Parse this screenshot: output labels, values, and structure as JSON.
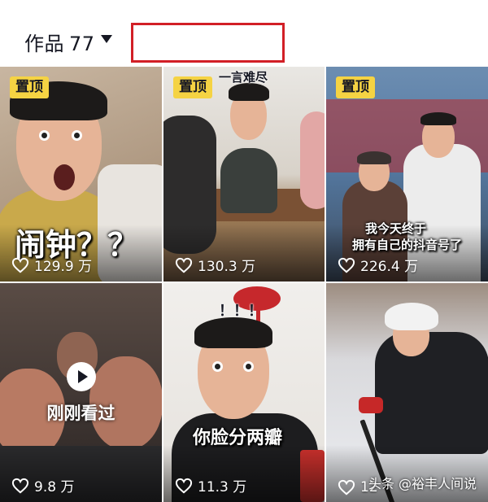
{
  "header": {
    "works_label": "作品",
    "works_count": "77"
  },
  "colors": {
    "pin_badge": "#f5d343",
    "highlight_box": "#d21f26"
  },
  "videos": [
    {
      "pinned": true,
      "pin_label": "置顶",
      "caption": "闹钟？？",
      "likes": "129.9 万"
    },
    {
      "pinned": true,
      "pin_label": "置顶",
      "top_caption": "一言难尽",
      "likes": "130.3 万"
    },
    {
      "pinned": true,
      "pin_label": "置顶",
      "caption_line1": "我今天终于",
      "caption_line2": "拥有自己的抖音号了",
      "likes": "226.4 万"
    },
    {
      "pinned": false,
      "status": "刚刚看过",
      "likes": "9.8 万"
    },
    {
      "pinned": false,
      "top_caption": "！！！",
      "caption": "你脸分两瓣",
      "likes": "11.3 万"
    },
    {
      "pinned": false,
      "likes": "12"
    }
  ],
  "watermark": "头条 @裕丰人间说"
}
